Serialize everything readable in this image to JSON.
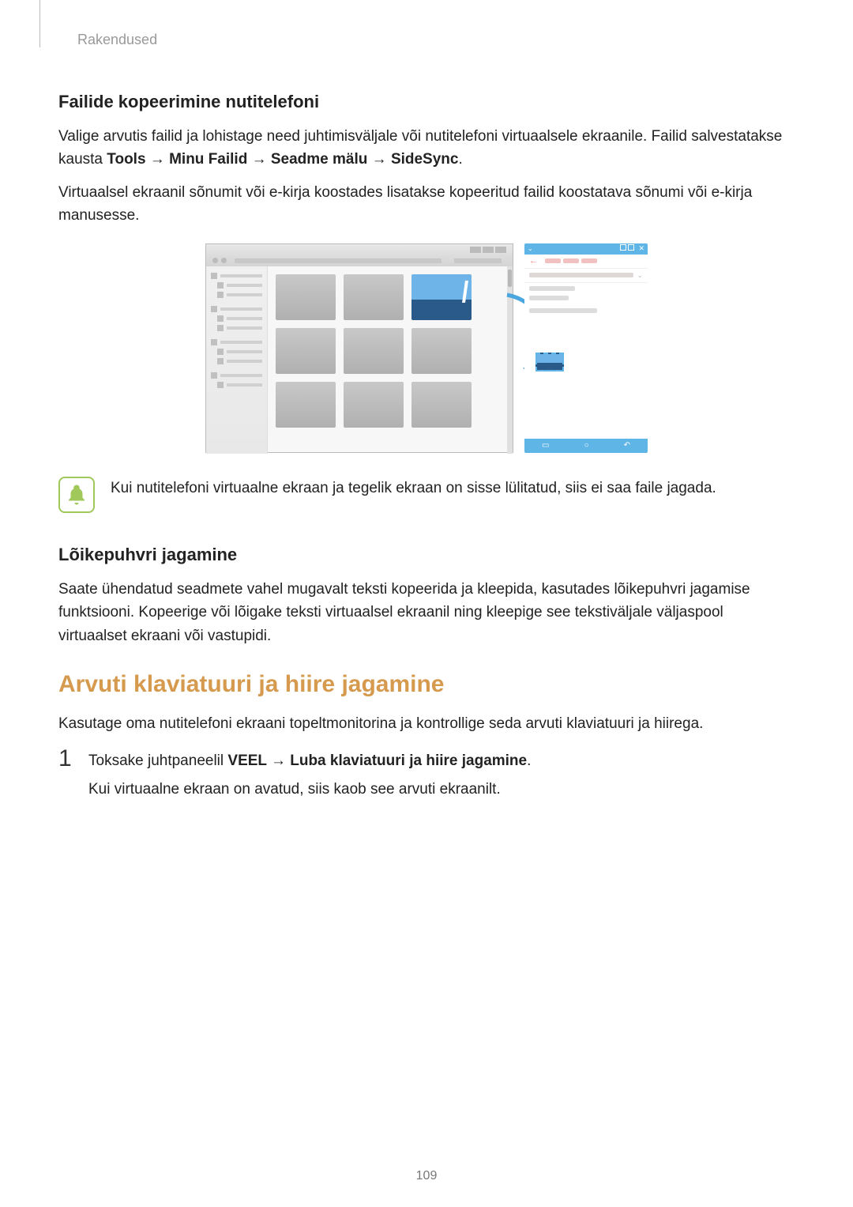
{
  "header": {
    "breadcrumb": "Rakendused"
  },
  "section1": {
    "heading": "Failide kopeerimine nutitelefoni",
    "p1_a": "Valige arvutis failid ja lohistage need juhtimisväljale või nutitelefoni virtuaalsele ekraanile. Failid salvestatakse kausta ",
    "p1_b1": "Tools",
    "p1_arrow": " → ",
    "p1_b2": "Minu Failid",
    "p1_b3": "Seadme mälu",
    "p1_b4": "SideSync",
    "p1_end": ".",
    "p2": "Virtuaalsel ekraanil sõnumit või e-kirja koostades lisatakse kopeeritud failid koostatava sõnumi või e-kirja manusesse."
  },
  "note": {
    "text": "Kui nutitelefoni virtuaalne ekraan ja tegelik ekraan on sisse lülitatud, siis ei saa faile jagada."
  },
  "section2": {
    "heading": "Lõikepuhvri jagamine",
    "p": "Saate ühendatud seadmete vahel mugavalt teksti kopeerida ja kleepida, kasutades lõikepuhvri jagamise funktsiooni. Kopeerige või lõigake teksti virtuaalsel ekraanil ning kleepige see tekstiväljale väljaspool virtuaalset ekraani või vastupidi."
  },
  "section3": {
    "title": "Arvuti klaviatuuri ja hiire jagamine",
    "intro": "Kasutage oma nutitelefoni ekraani topeltmonitorina ja kontrollige seda arvuti klaviatuuri ja hiirega.",
    "step1_num": "1",
    "step1_a": "Toksake juhtpaneelil ",
    "step1_b1": "VEEL",
    "step1_arrow": " → ",
    "step1_b2": "Luba klaviatuuri ja hiire jagamine",
    "step1_end": ".",
    "step1_p2": "Kui virtuaalne ekraan on avatud, siis kaob see arvuti ekraanilt."
  },
  "page_number": "109"
}
